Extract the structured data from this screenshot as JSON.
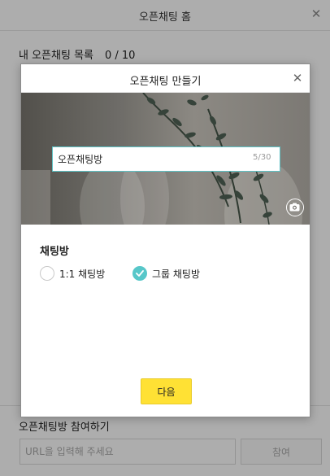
{
  "window": {
    "title": "오픈채팅 홈",
    "close_glyph": "✕"
  },
  "list": {
    "header_label": "내 오픈채팅 목록",
    "count": "0 / 10"
  },
  "join": {
    "label": "오픈채팅방 참여하기",
    "url_placeholder": "URL을 입력해 주세요",
    "button_label": "참여"
  },
  "modal": {
    "title": "오픈채팅 만들기",
    "close_glyph": "✕",
    "name_input_value": "오픈채팅방",
    "name_counter": "5/30",
    "section_title": "채팅방",
    "options": [
      {
        "label": "1:1 채팅방",
        "selected": false
      },
      {
        "label": "그룹 채팅방",
        "selected": true
      }
    ],
    "next_button_label": "다음",
    "camera_icon": "camera-icon"
  },
  "colors": {
    "accent_teal": "#57c7c9",
    "primary_yellow": "#ffe134",
    "overlay": "rgba(0,0,0,0.32)"
  }
}
